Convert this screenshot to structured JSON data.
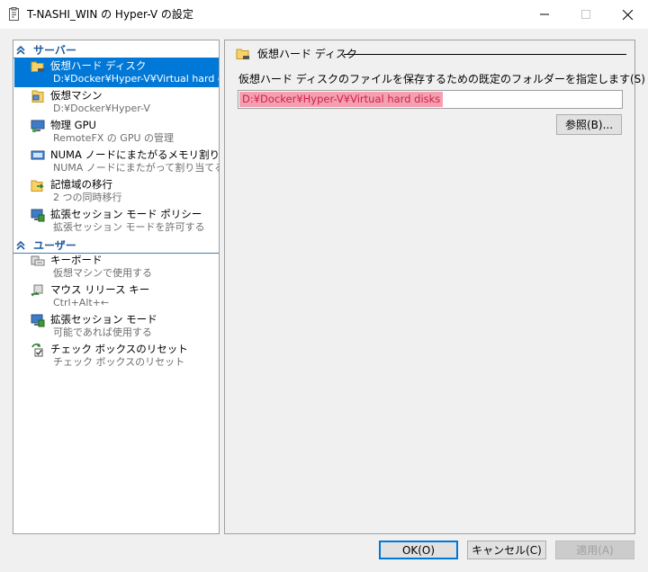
{
  "window": {
    "title": "T-NASHI_WIN の Hyper-V の設定",
    "accent": "#0078d7"
  },
  "sidebar": {
    "sections": [
      {
        "label": "サーバー"
      },
      {
        "label": "ユーザー"
      }
    ],
    "items": [
      {
        "name": "仮想ハード ディスク",
        "sub": "D:¥Docker¥Hyper-V¥Virtual hard di",
        "icon": "folder-disk-icon"
      },
      {
        "name": "仮想マシン",
        "sub": "D:¥Docker¥Hyper-V",
        "icon": "vm-folder-icon"
      },
      {
        "name": "物理 GPU",
        "sub": "RemoteFX の GPU の管理",
        "icon": "gpu-monitor-icon"
      },
      {
        "name": "NUMA ノードにまたがるメモリ割り当て",
        "sub": "NUMA ノードにまたがって割り当てる",
        "icon": "numa-icon"
      },
      {
        "name": "記憶域の移行",
        "sub": "2 つの同時移行",
        "icon": "storage-migration-icon"
      },
      {
        "name": "拡張セッション モード ポリシー",
        "sub": "拡張セッション モードを許可する",
        "icon": "enhanced-session-policy-icon"
      },
      {
        "name": "キーボード",
        "sub": "仮想マシンで使用する",
        "icon": "keyboard-icon"
      },
      {
        "name": "マウス リリース キー",
        "sub": "Ctrl+Alt+←",
        "icon": "mouse-release-icon"
      },
      {
        "name": "拡張セッション モード",
        "sub": "可能であれば使用する",
        "icon": "enhanced-session-icon"
      },
      {
        "name": "チェック ボックスのリセット",
        "sub": "チェック ボックスのリセット",
        "icon": "checkbox-reset-icon"
      }
    ]
  },
  "panel": {
    "group_title": "仮想ハード ディスク",
    "field_label": "仮想ハード ディスクのファイルを保存するための既定のフォルダーを指定します(S)",
    "path_value": "D:¥Docker¥Hyper-V¥Virtual hard disks",
    "browse_label": "参照(B)..."
  },
  "buttons": {
    "ok": "OK(O)",
    "cancel": "キャンセル(C)",
    "apply": "適用(A)"
  }
}
